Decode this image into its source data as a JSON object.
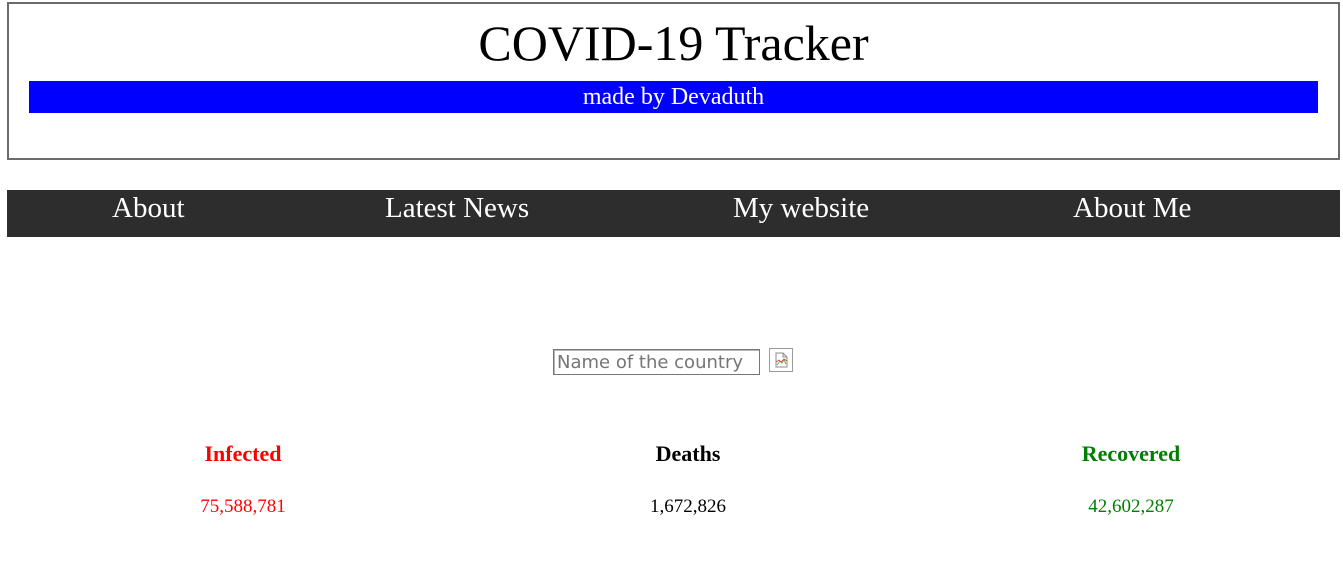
{
  "header": {
    "title": "COVID-19 Tracker",
    "subtitle": "made by Devaduth",
    "subtitle_bg_color": "#0000ff"
  },
  "nav": {
    "items": [
      {
        "label": "About"
      },
      {
        "label": "Latest News"
      },
      {
        "label": "My website"
      },
      {
        "label": "About Me"
      }
    ],
    "bg_color": "#2d2d2d"
  },
  "search": {
    "placeholder": "Name of the country",
    "value": "",
    "button_icon": "broken-image-icon"
  },
  "stats": {
    "infected": {
      "label": "Infected",
      "value": "75,588,781",
      "color": "#ff0000"
    },
    "deaths": {
      "label": "Deaths",
      "value": "1,672,826",
      "color": "#000000"
    },
    "recovered": {
      "label": "Recovered",
      "value": "42,602,287",
      "color": "#008000"
    }
  }
}
